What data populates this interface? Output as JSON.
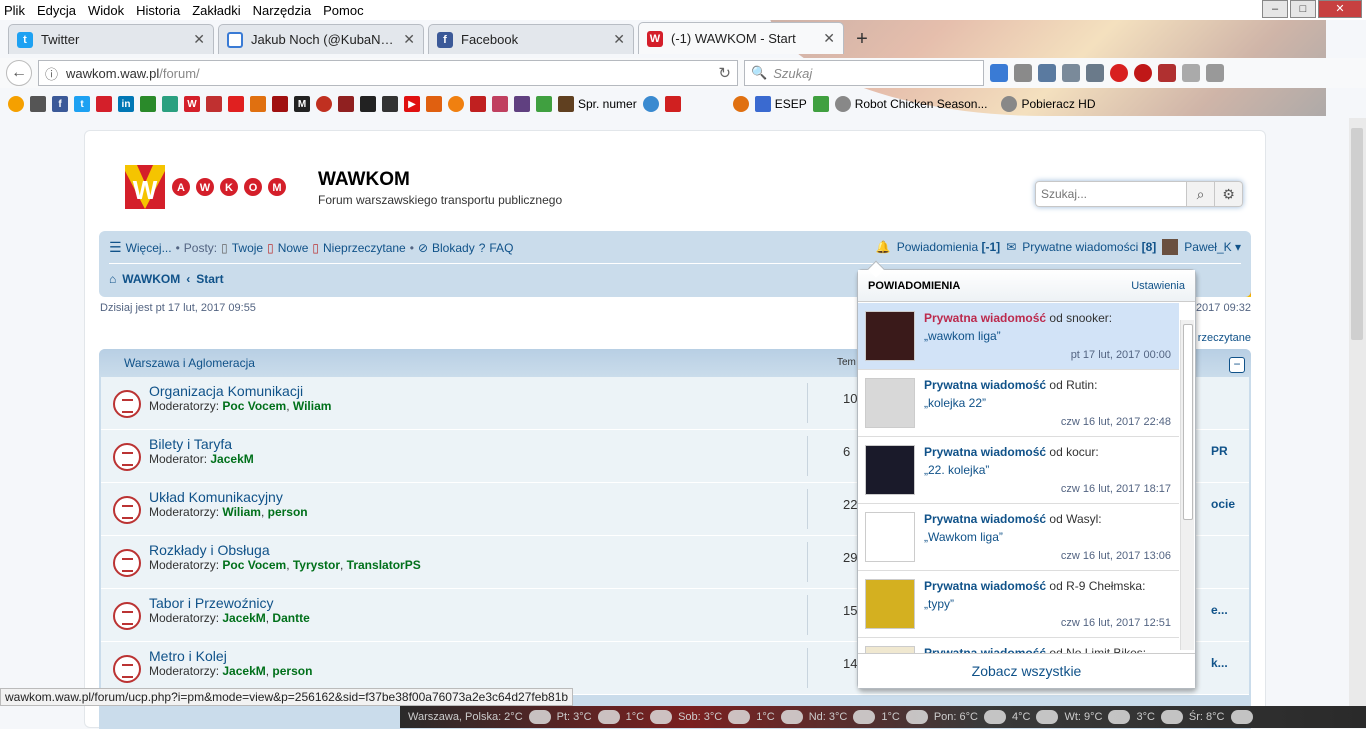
{
  "browser": {
    "menu": [
      "Plik",
      "Edycja",
      "Widok",
      "Historia",
      "Zakładki",
      "Narzędzia",
      "Pomoc"
    ],
    "tabs": [
      {
        "label": "Twitter",
        "color": "#1da1f2",
        "glyph": "t"
      },
      {
        "label": "Jakub Noch (@KubaNoch) ...",
        "color": "#ffffff",
        "glyph": "○"
      },
      {
        "label": "Facebook",
        "color": "#3b5998",
        "glyph": "f"
      },
      {
        "label": "(-1) WAWKOM - Start",
        "color": "#d41f2a",
        "glyph": "W"
      }
    ],
    "new_tab": "+",
    "url_host": "wawkom.waw.pl",
    "url_path": "/forum/",
    "search_placeholder": "Szukaj",
    "bookmarks_text": [
      "Spr. numer",
      "ESEP",
      "Robot Chicken Season...",
      "Pobieracz HD"
    ]
  },
  "forum": {
    "site_name": "WAWKOM",
    "site_desc": "Forum warszawskiego transportu publicznego",
    "search_placeholder": "Szukaj...",
    "nav": {
      "more": "Więcej...",
      "posts_label": "Posty:",
      "yours": "Twoje",
      "new": "Nowe",
      "unread": "Nieprzeczytane",
      "blocks": "Blokady",
      "faq": "FAQ",
      "notifications": "Powiadomienia",
      "notif_count": "[-1]",
      "pm": "Prywatne wiadomości",
      "pm_count": "[8]",
      "user": "Paweł_K"
    },
    "breadcrumb": [
      "WAWKOM",
      "Start"
    ],
    "date_now": "Dzisiaj jest pt 17 lut, 2017 09:55",
    "last_visit": "2017 09:32",
    "unread_link": "rzeczytane",
    "category": "Warszawa i Aglomeracja",
    "topics_header": "Tem",
    "forums": [
      {
        "title": "Organizacja Komunikacji",
        "mod_label": "Moderatorzy:",
        "mods": [
          "Poc Vocem",
          "Wiliam"
        ],
        "num": "10",
        "last": ""
      },
      {
        "title": "Bilety i Taryfa",
        "mod_label": "Moderator:",
        "mods": [
          "JacekM"
        ],
        "num": "6",
        "last": "PR"
      },
      {
        "title": "Układ Komunikacyjny",
        "mod_label": "Moderatorzy:",
        "mods": [
          "Wiliam",
          "person"
        ],
        "num": "22",
        "last": "ocie"
      },
      {
        "title": "Rozkłady i Obsługa",
        "mod_label": "Moderatorzy:",
        "mods": [
          "Poc Vocem",
          "Tyrystor",
          "TranslatorPS"
        ],
        "num": "29",
        "last": ""
      },
      {
        "title": "Tabor i Przewoźnicy",
        "mod_label": "Moderatorzy:",
        "mods": [
          "JacekM",
          "Dantte"
        ],
        "num": "15",
        "last": "e..."
      },
      {
        "title": "Metro i Kolej",
        "mod_label": "Moderatorzy:",
        "mods": [
          "JacekM",
          "person"
        ],
        "num": "14",
        "last": "k..."
      }
    ]
  },
  "notifications": {
    "title": "POWIADOMIENIA",
    "settings": "Ustawienia",
    "footer": "Zobacz wszystkie",
    "items": [
      {
        "type": "Prywatna wiadomość",
        "from": "od snooker:",
        "subject": "„wawkom liga”",
        "time": "pt 17 lut, 2017 00:00",
        "avatar": "#3a1a1a",
        "selected": true
      },
      {
        "type": "Prywatna wiadomość",
        "from": "od Rutin:",
        "subject": "„kolejka 22”",
        "time": "czw 16 lut, 2017 22:48",
        "avatar": "#d8d8d8",
        "selected": false
      },
      {
        "type": "Prywatna wiadomość",
        "from": "od kocur:",
        "subject": "„22. kolejka”",
        "time": "czw 16 lut, 2017 18:17",
        "avatar": "#1a1a2a",
        "selected": false
      },
      {
        "type": "Prywatna wiadomość",
        "from": "od Wasyl:",
        "subject": "„Wawkom liga”",
        "time": "czw 16 lut, 2017 13:06",
        "avatar": "#ffffff",
        "selected": false
      },
      {
        "type": "Prywatna wiadomość",
        "from": "od R-9 Chełmska:",
        "subject": "„typy”",
        "time": "czw 16 lut, 2017 12:51",
        "avatar": "#d4b020",
        "selected": false
      },
      {
        "type": "Prywatna wiadomość",
        "from": "od No Limit Bikes:",
        "subject": "",
        "time": "",
        "avatar": "#f0e8d0",
        "selected": false
      }
    ]
  },
  "status_url": "wawkom.waw.pl/forum/ucp.php?i=pm&mode=view&p=256162&sid=f37be38f00a76073a2e3c64d27feb81b",
  "weather": [
    "Warszawa, Polska: 2°C",
    "Pt: 3°C",
    "1°C",
    "Sob: 3°C",
    "1°C",
    "Nd: 3°C",
    "1°C",
    "Pon: 6°C",
    "4°C",
    "Wt: 9°C",
    "3°C",
    "Śr: 8°C"
  ]
}
